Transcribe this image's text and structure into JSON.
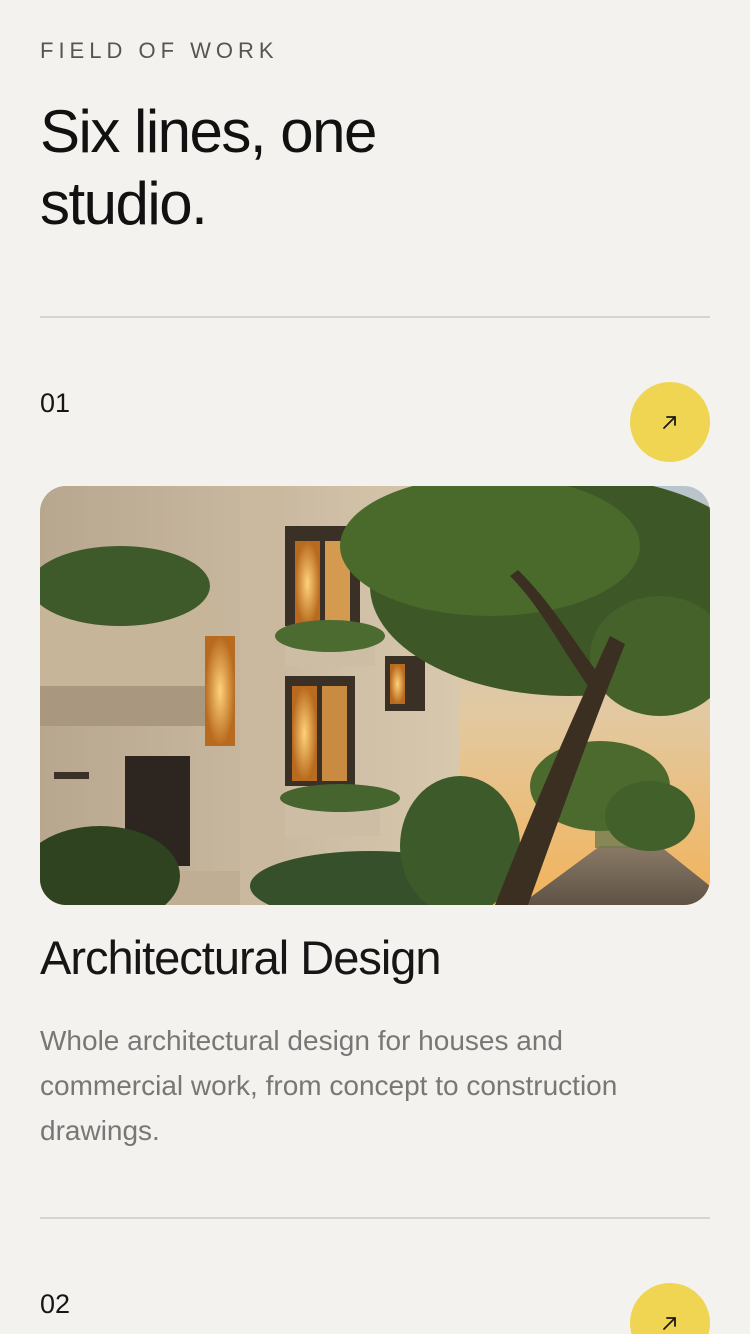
{
  "section": {
    "eyebrow": "FIELD OF WORK",
    "headline": "Six lines, one studio."
  },
  "services": [
    {
      "index": "01",
      "title": "Architectural Design",
      "description": "Whole architectural design for houses and commercial work, from concept to construction drawings.",
      "image_alt": "Modern stone townhouse with planted balconies beside a tree-lined street at sunset",
      "arrow_icon": "arrow-up-right-icon"
    },
    {
      "index": "02",
      "arrow_icon": "arrow-up-right-icon"
    }
  ],
  "colors": {
    "background": "#f4f2ee",
    "accent": "#efd552",
    "text": "#161616",
    "muted_text": "#777777",
    "divider": "#d6d4cf"
  }
}
